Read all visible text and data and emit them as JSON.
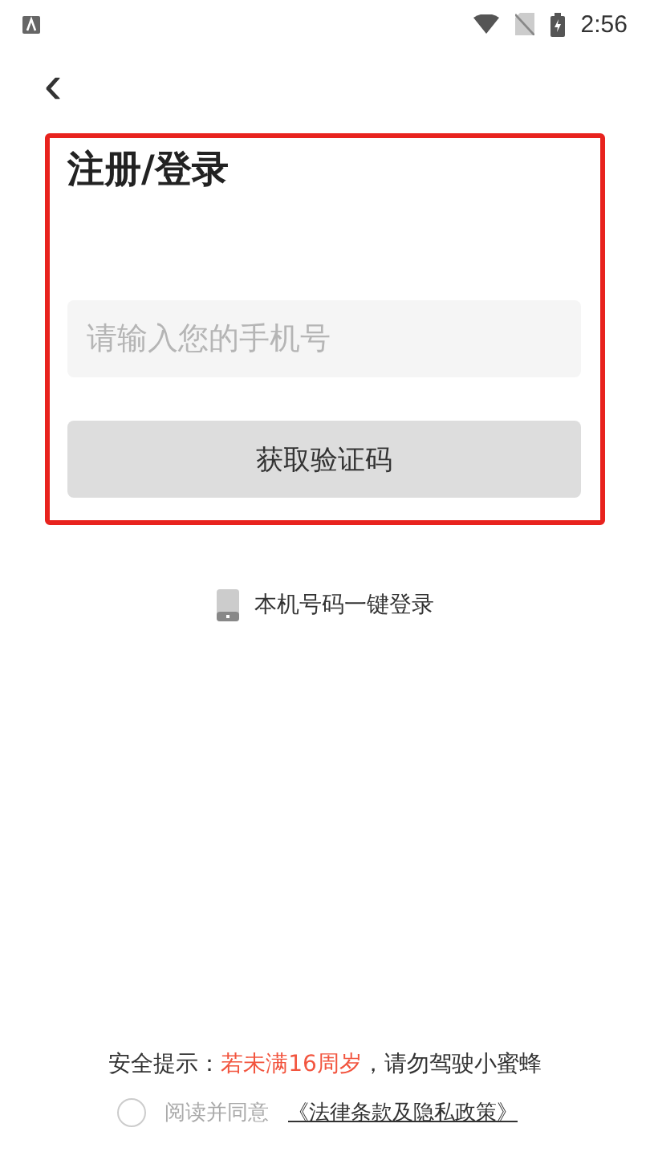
{
  "status_bar": {
    "time": "2:56"
  },
  "header": {
    "back_label": "‹"
  },
  "form": {
    "highlighted": true,
    "title": "注册/登录",
    "phone_field": {
      "placeholder": "请输入您的手机号"
    },
    "submit_button": "获取验证码"
  },
  "one_click_login": "本机号码一键登录",
  "safety_tip": {
    "prefix": "安全提示：",
    "warning": "若未满16周岁",
    "suffix": "，请勿驾驶小蜜蜂"
  },
  "agreement": {
    "checked": false,
    "text": "阅读并同意",
    "link": "《法律条款及隐私政策》"
  }
}
